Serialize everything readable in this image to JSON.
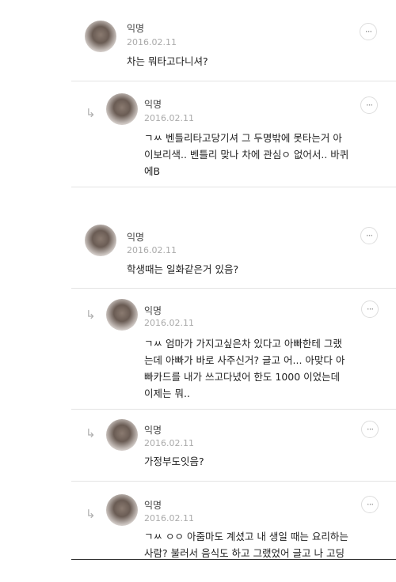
{
  "comments": [
    {
      "name": "익명",
      "date": "2016.02.11",
      "body_lines": [
        "차는 뭐타고다니셔?"
      ]
    },
    {
      "name": "익명",
      "date": "2016.02.11",
      "body_lines": [
        "ㄱㅆ 벤틀리타고당기셔 그 두명밖에 못타는거 아",
        "이보리색.. 벤틀리 맞나 차에 관심ㅇ 없어서.. 바퀴",
        "에B"
      ]
    },
    {
      "name": "익명",
      "date": "2016.02.11",
      "body_lines": [
        "학생때는 일화같은거 있음?"
      ]
    },
    {
      "name": "익명",
      "date": "2016.02.11",
      "body_lines": [
        "ㄱㅆ 엄마가 가지고싶은차 있다고 아빠한테 그랬",
        "는데 아빠가 바로 사주신거? 글고 어... 아맞다 아",
        "빠카드를 내가 쓰고다녔어 한도 1000 이었는데",
        "이제는 뭐.."
      ]
    },
    {
      "name": "익명",
      "date": "2016.02.11",
      "body_lines": [
        "가정부도잇음?"
      ]
    },
    {
      "name": "익명",
      "date": "2016.02.11",
      "body_lines": [
        "ㄱㅆ ㅇㅇ 아줌마도 계셨고 내 생일 때는 요리하는",
        "사람? 불러서 음식도 하고 그랬었어 글고 나 고딩"
      ]
    }
  ],
  "icons": {
    "more": "more-options-icon",
    "reply": "reply-arrow-icon"
  },
  "more_glyph": "···",
  "reply_glyph": "↳"
}
